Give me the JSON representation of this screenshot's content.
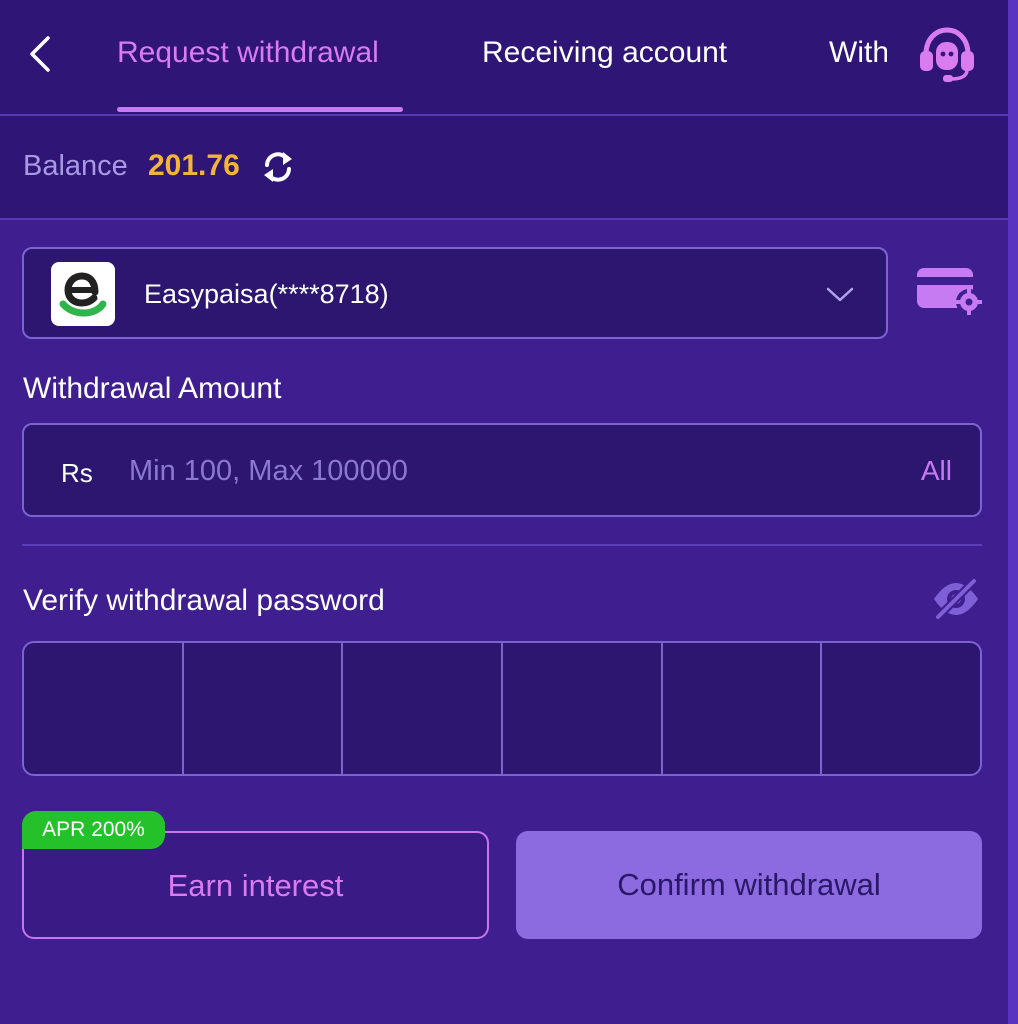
{
  "header": {
    "tabs": [
      {
        "label": "Request withdrawal",
        "active": true
      },
      {
        "label": "Receiving account",
        "active": false
      },
      {
        "label": "Withdrawal history",
        "visible_text": "With",
        "active": false
      }
    ],
    "back_icon": "chevron-left-icon",
    "support_icon": "headset-icon"
  },
  "balance": {
    "label": "Balance",
    "value": "201.76",
    "refresh_icon": "refresh-icon"
  },
  "account": {
    "provider_logo": "easypaisa-logo",
    "name": "Easypaisa(****8718)",
    "dropdown_icon": "chevron-down-icon",
    "manage_icon": "card-settings-icon"
  },
  "amount": {
    "title": "Withdrawal Amount",
    "currency": "Rs",
    "placeholder": "Min 100, Max 100000",
    "value": "",
    "all_label": "All"
  },
  "password": {
    "title": "Verify withdrawal password",
    "visibility_icon": "eye-off-icon",
    "digits": [
      "",
      "",
      "",
      "",
      "",
      ""
    ]
  },
  "actions": {
    "apr_badge": "APR 200%",
    "earn_label": "Earn interest",
    "confirm_label": "Confirm withdrawal"
  },
  "colors": {
    "background": "#3f1e8f",
    "header_bg": "#2f1576",
    "accent_pink": "#d87cf0",
    "balance_gold": "#f4b43a",
    "badge_green": "#25c12a",
    "confirm_bg": "#8c6ae0"
  }
}
